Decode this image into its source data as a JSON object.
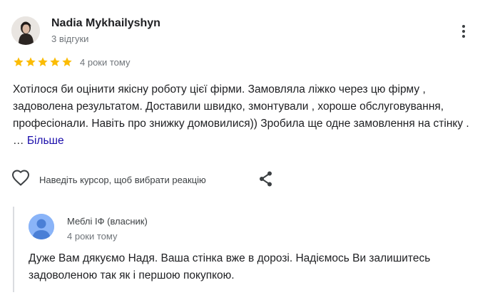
{
  "review": {
    "author_name": "Nadia Mykhailyshyn",
    "author_meta": "3 відгуки",
    "rating": 5,
    "rating_max": 5,
    "star_color": "#fbbc04",
    "date": "4 роки тому",
    "text": "Хотілося би оцінити якісну роботу цієї фірми. Замовляла ліжко через цю фірму , задоволена результатом. Доставили швидко, змонтували , хороше обслуговування, професіонали. Навіть про знижку домовилися)) Зробила ще одне замовлення на стінку . … ",
    "more_label": "Більше",
    "more_icon": "more-vert-icon"
  },
  "actions": {
    "like_icon": "heart-outline-icon",
    "reaction_hint": "Наведіть курсор, щоб вибрати реакцію",
    "share_icon": "share-icon"
  },
  "owner_reply": {
    "name": "Меблі ІФ (власник)",
    "date": "4 роки тому",
    "text": "Дуже Вам дякуємо Надя. Ваша стінка вже в дорозі. Надіємось Ви залишитесь задоволеною так як і першою покупкою.",
    "avatar_icon": "default-user-avatar-icon",
    "avatar_color": "#8ab4f8"
  }
}
